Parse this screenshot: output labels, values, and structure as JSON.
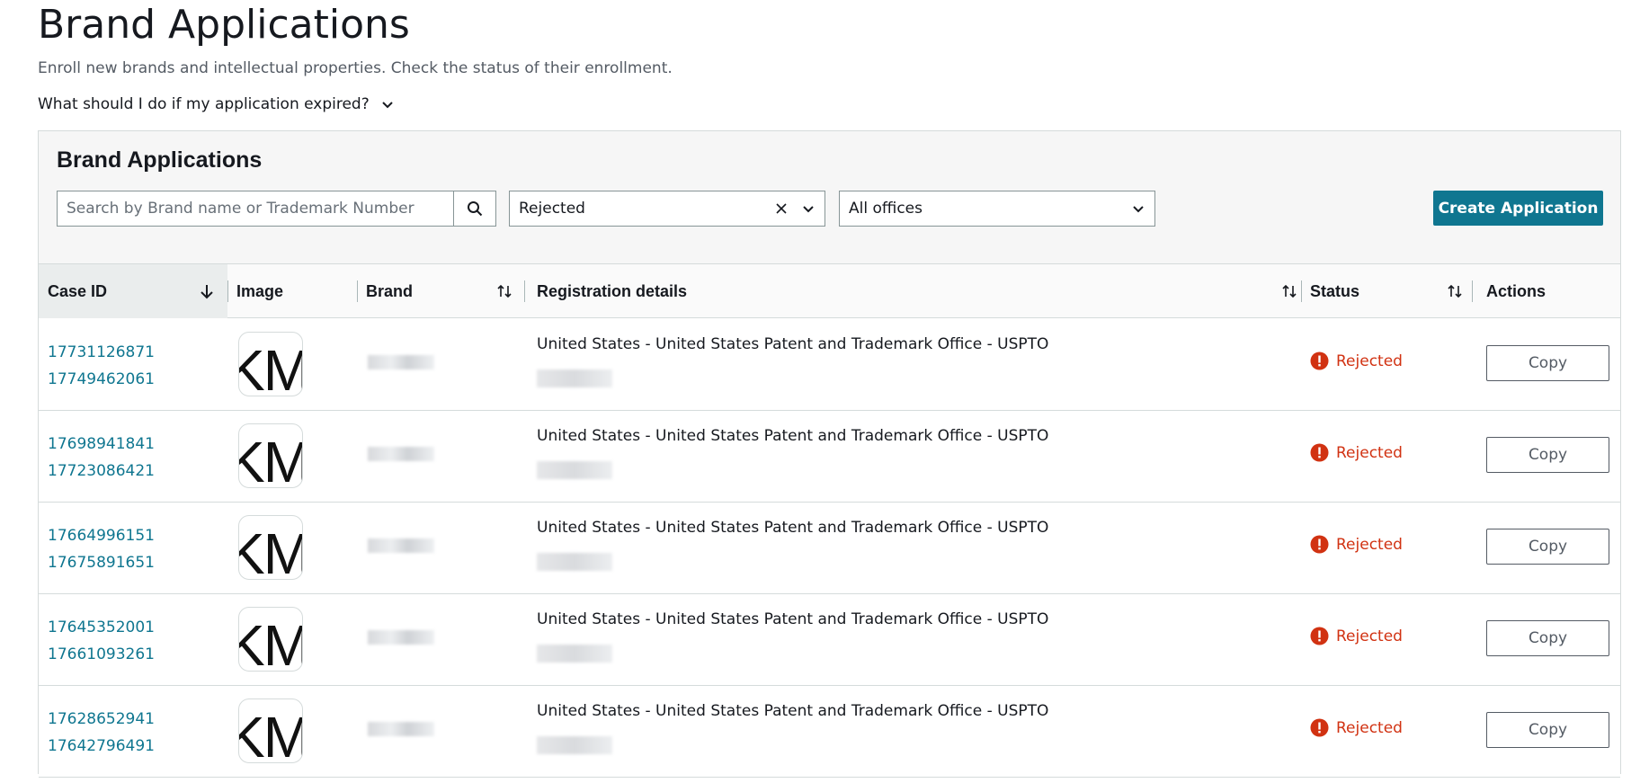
{
  "page": {
    "title": "Brand Applications",
    "subtitle": "Enroll new brands and intellectual properties. Check the status of their enrollment.",
    "faq_label": "What should I do if my application expired?"
  },
  "panel": {
    "title": "Brand Applications",
    "search_placeholder": "Search by Brand name or Trademark Number",
    "status_filter": "Rejected",
    "office_filter": "All offices",
    "create_label": "Create Application"
  },
  "table": {
    "columns": {
      "case_id": "Case ID",
      "image": "Image",
      "brand": "Brand",
      "registration": "Registration details",
      "status": "Status",
      "actions": "Actions"
    },
    "rows": [
      {
        "case_ids": [
          "17731126871",
          "17749462061"
        ],
        "thumb": "KM",
        "registration": "United States - United States Patent and Trademark Office - USPTO",
        "status": "Rejected",
        "action": "Copy"
      },
      {
        "case_ids": [
          "17698941841",
          "17723086421"
        ],
        "thumb": "KM",
        "registration": "United States - United States Patent and Trademark Office - USPTO",
        "status": "Rejected",
        "action": "Copy"
      },
      {
        "case_ids": [
          "17664996151",
          "17675891651"
        ],
        "thumb": "KM",
        "registration": "United States - United States Patent and Trademark Office - USPTO",
        "status": "Rejected",
        "action": "Copy"
      },
      {
        "case_ids": [
          "17645352001",
          "17661093261"
        ],
        "thumb": "KM",
        "registration": "United States - United States Patent and Trademark Office - USPTO",
        "status": "Rejected",
        "action": "Copy"
      },
      {
        "case_ids": [
          "17628652941",
          "17642796491"
        ],
        "thumb": "KM",
        "registration": "United States - United States Patent and Trademark Office - USPTO",
        "status": "Rejected",
        "action": "Copy"
      }
    ]
  },
  "colors": {
    "link": "#0f7690",
    "primary": "#0f7690",
    "error": "#d13212"
  },
  "icons": [
    "chevron-down-icon",
    "search-icon",
    "clear-icon",
    "sort-descending-icon",
    "sort-icon",
    "error-icon"
  ]
}
